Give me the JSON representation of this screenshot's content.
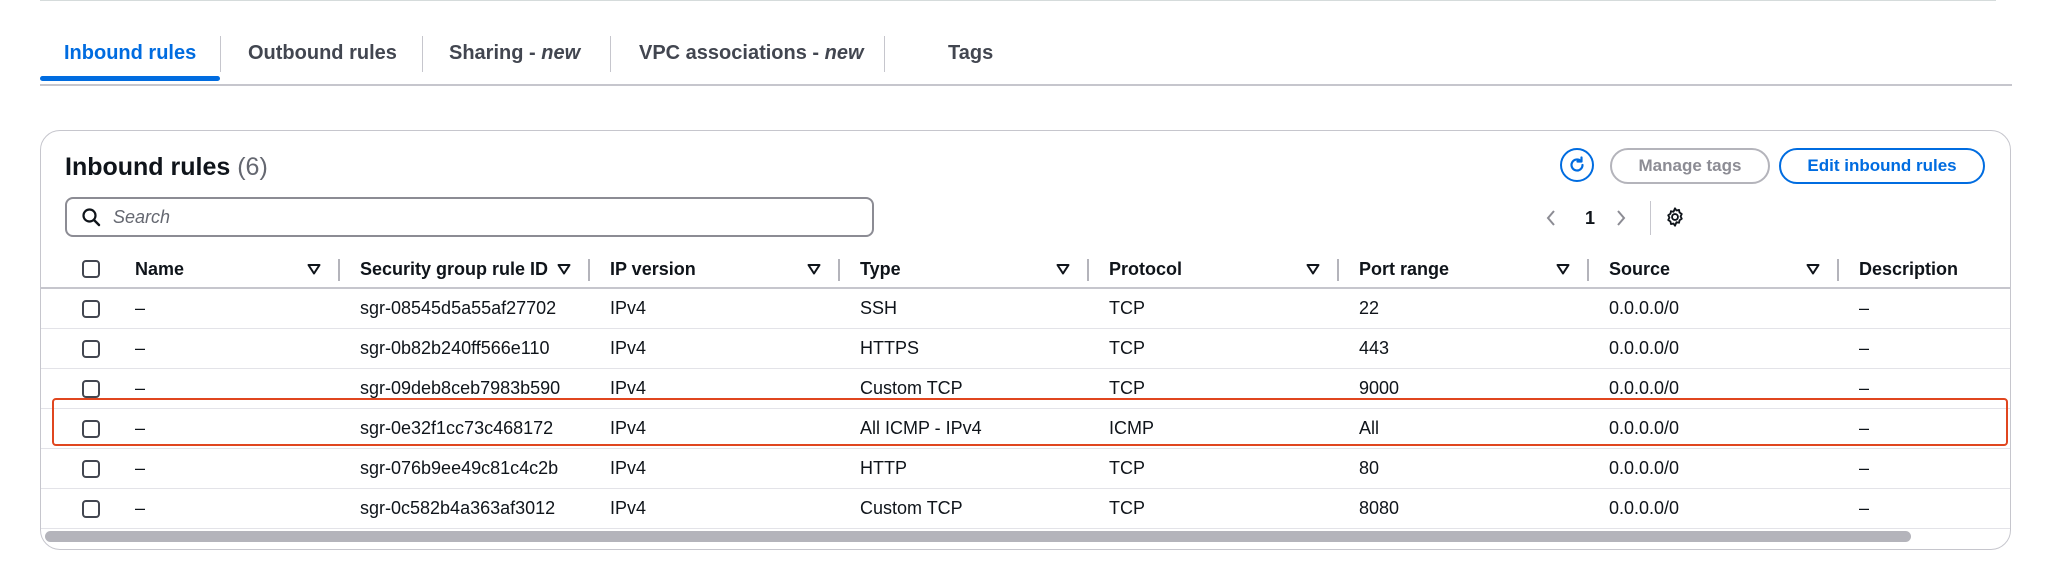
{
  "tabs": [
    {
      "label": "Inbound rules",
      "badge": ""
    },
    {
      "label": "Outbound rules",
      "badge": ""
    },
    {
      "label": "Sharing - ",
      "badge": "new"
    },
    {
      "label": "VPC associations - ",
      "badge": "new"
    },
    {
      "label": "Tags",
      "badge": ""
    }
  ],
  "panel": {
    "title": "Inbound rules",
    "count": "(6)",
    "manage_tags_label": "Manage tags",
    "edit_label": "Edit inbound rules",
    "search_placeholder": "Search",
    "page": "1"
  },
  "table": {
    "columns": [
      "Name",
      "Security group rule ID",
      "IP version",
      "Type",
      "Protocol",
      "Port range",
      "Source",
      "Description"
    ],
    "rows": [
      {
        "name": "–",
        "rule_id": "sgr-08545d5a55af27702",
        "ip_version": "IPv4",
        "type": "SSH",
        "protocol": "TCP",
        "port_range": "22",
        "source": "0.0.0.0/0",
        "description": "–"
      },
      {
        "name": "–",
        "rule_id": "sgr-0b82b240ff566e110",
        "ip_version": "IPv4",
        "type": "HTTPS",
        "protocol": "TCP",
        "port_range": "443",
        "source": "0.0.0.0/0",
        "description": "–"
      },
      {
        "name": "–",
        "rule_id": "sgr-09deb8ceb7983b590",
        "ip_version": "IPv4",
        "type": "Custom TCP",
        "protocol": "TCP",
        "port_range": "9000",
        "source": "0.0.0.0/0",
        "description": "–"
      },
      {
        "name": "–",
        "rule_id": "sgr-0e32f1cc73c468172",
        "ip_version": "IPv4",
        "type": "All ICMP - IPv4",
        "protocol": "ICMP",
        "port_range": "All",
        "source": "0.0.0.0/0",
        "description": "–"
      },
      {
        "name": "–",
        "rule_id": "sgr-076b9ee49c81c4c2b",
        "ip_version": "IPv4",
        "type": "HTTP",
        "protocol": "TCP",
        "port_range": "80",
        "source": "0.0.0.0/0",
        "description": "–"
      },
      {
        "name": "–",
        "rule_id": "sgr-0c582b4a363af3012",
        "ip_version": "IPv4",
        "type": "Custom TCP",
        "protocol": "TCP",
        "port_range": "8080",
        "source": "0.0.0.0/0",
        "description": "–"
      }
    ]
  },
  "highlighted_row": 3,
  "colors": {
    "accent": "#006ce0",
    "highlight": "#e0461f",
    "text": "#0f141a"
  },
  "icons": [
    "search-icon",
    "refresh-icon",
    "chevron-left-icon",
    "chevron-right-icon",
    "gear-icon",
    "sort-down-icon"
  ]
}
